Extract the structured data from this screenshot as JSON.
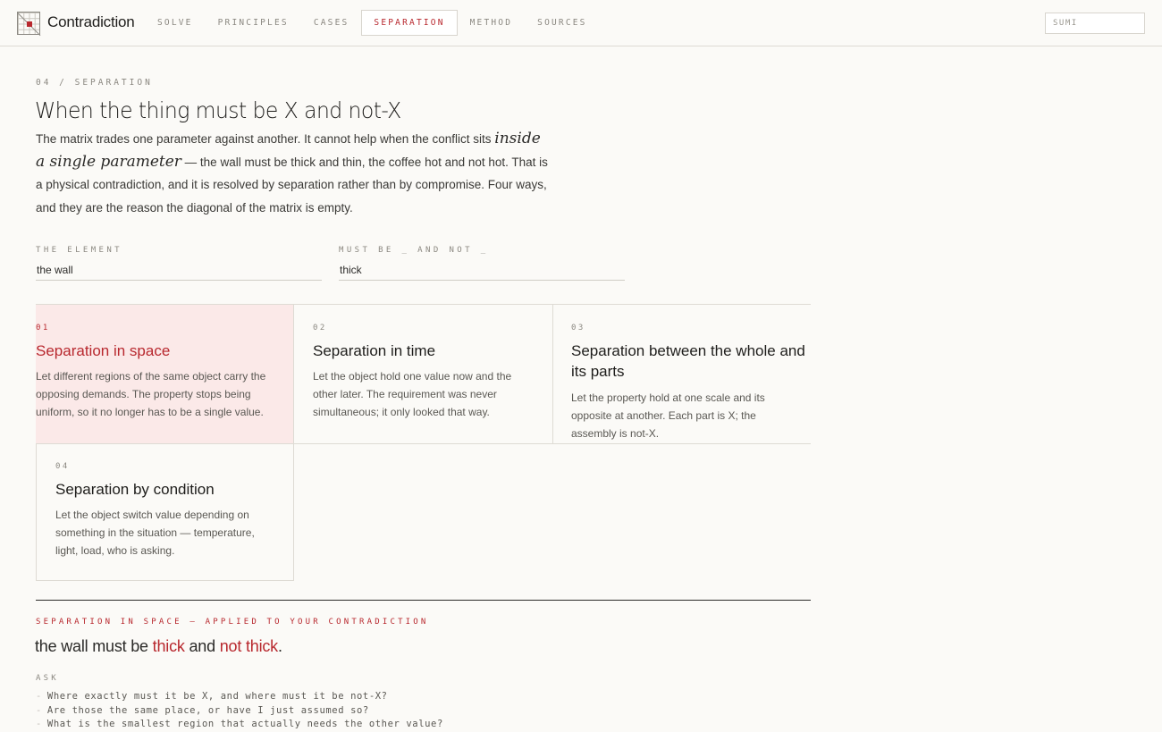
{
  "header": {
    "brand": "Contradiction",
    "nav": [
      "SOLVE",
      "PRINCIPLES",
      "CASES",
      "SEPARATION",
      "METHOD",
      "SOURCES"
    ],
    "active_nav": "SEPARATION",
    "search_placeholder": "SUMI"
  },
  "intro": {
    "breadcrumb": "04 / SEPARATION",
    "title": "When the thing must be X and not-X",
    "lead_before": "The matrix trades one parameter against another. It cannot help when the conflict sits ",
    "lead_emphasis": "inside a single parameter",
    "lead_after": " — the wall must be thick and thin, the coffee hot and not hot. That is a physical contradiction, and it is resolved by separation rather than by compromise. Four ways, and they are the reason the diagonal of the matrix is empty."
  },
  "fields": {
    "element_label": "THE ELEMENT",
    "element_value": "the wall",
    "property_label": "MUST BE _ AND NOT _",
    "property_value": "thick"
  },
  "cards": [
    {
      "num": "01",
      "title": "Separation in space",
      "body": "Let different regions of the same object carry the opposing demands. The property stops being uniform, so it no longer has to be a single value.",
      "selected": true
    },
    {
      "num": "02",
      "title": "Separation in time",
      "body": "Let the object hold one value now and the other later. The requirement was never simultaneous; it only looked that way.",
      "selected": false
    },
    {
      "num": "03",
      "title": "Separation between the whole and its parts",
      "body": "Let the property hold at one scale and its opposite at another. Each part is X; the assembly is not-X.",
      "selected": false
    },
    {
      "num": "04",
      "title": "Separation by condition",
      "body": "Let the object switch value depending on something in the situation — temperature, light, load, who is asking.",
      "selected": false
    }
  ],
  "applied": {
    "label": "SEPARATION IN SPACE — APPLIED TO YOUR CONTRADICTION",
    "s_prefix": "the wall must be ",
    "s_word1": "thick",
    "s_mid": " and ",
    "s_word2": "not thick",
    "s_end": ".",
    "ask_label": "ASK",
    "questions": [
      "Where exactly must it be X, and where must it be not-X?",
      "Are those the same place, or have I just assumed so?",
      "What is the smallest region that actually needs the other value?"
    ]
  },
  "colors": {
    "accent": "#b8282e",
    "selected_bg": "#fbe9e8",
    "background": "#fbfaf7"
  }
}
